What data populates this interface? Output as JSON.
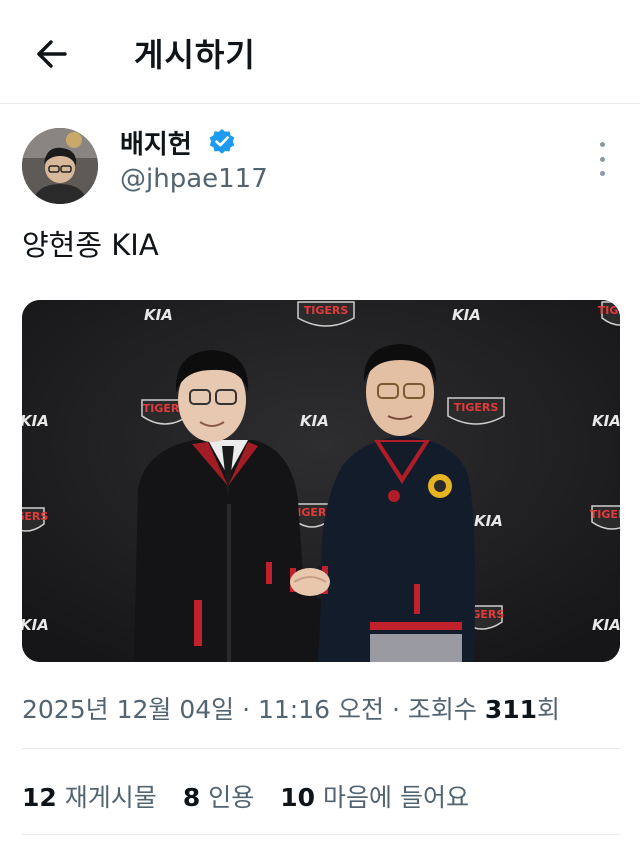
{
  "header": {
    "back_icon": "arrow-left-icon",
    "title": "게시하기"
  },
  "author": {
    "display_name": "배지헌",
    "verified_icon": "verified-badge-icon",
    "verified_color": "#1d9bf0",
    "handle": "@jhpae117",
    "more_icon": "more-vertical-icon"
  },
  "post": {
    "text": "양현종 KIA",
    "image": {
      "backdrop_logos": [
        "KIA",
        "TIGERS"
      ]
    }
  },
  "meta": {
    "date": "2025년 12월 04일",
    "separator": "·",
    "time": "11:16 오전",
    "views_prefix": "조회수",
    "views_count": "311",
    "views_suffix": "회"
  },
  "stats": {
    "reposts_count": "12",
    "reposts_label": "재게시물",
    "quotes_count": "8",
    "quotes_label": "인용",
    "likes_count": "10",
    "likes_label": "마음에 들어요"
  }
}
